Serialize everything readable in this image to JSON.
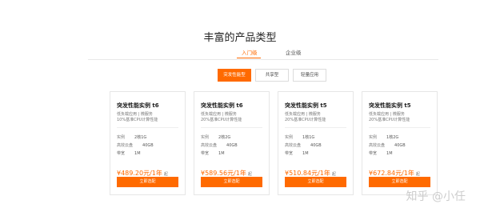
{
  "section": {
    "title": "丰富的产品类型"
  },
  "tabs": [
    {
      "label": "入门级",
      "active": true
    },
    {
      "label": "企业级",
      "active": false
    }
  ],
  "filters": [
    {
      "label": "突发性能型",
      "active": true
    },
    {
      "label": "共享型",
      "active": false
    },
    {
      "label": "轻量应用",
      "active": false
    }
  ],
  "cards": [
    {
      "title": "突发性能实例 t6",
      "line1": "低负载应用 | 微服务",
      "line2": "10%基准CPU计算性能",
      "specs": [
        {
          "label": "实例",
          "value": "2核1G"
        },
        {
          "label": "高效云盘",
          "value": "40GB"
        },
        {
          "label": "带宽",
          "value": "1M"
        }
      ],
      "price": "¥489.20元/1年",
      "price_suffix": "起",
      "button": "立即选配"
    },
    {
      "title": "突发性能实例 t6",
      "line1": "低负载应用 | 微服务",
      "line2": "20%基准CPU计算性能",
      "specs": [
        {
          "label": "实例",
          "value": "2核2G"
        },
        {
          "label": "高效云盘",
          "value": "40GB"
        },
        {
          "label": "带宽",
          "value": "1M"
        }
      ],
      "price": "¥589.56元/1年",
      "price_suffix": "起",
      "button": "立即选配"
    },
    {
      "title": "突发性能实例 t5",
      "line1": "低负载应用 | 微服务",
      "line2": "20%基准CPU计算性能",
      "specs": [
        {
          "label": "实例",
          "value": "1核1G"
        },
        {
          "label": "高效云盘",
          "value": "40GB"
        },
        {
          "label": "带宽",
          "value": "1M"
        }
      ],
      "price": "¥510.84元/1年",
      "price_suffix": "起",
      "button": "立即选配"
    },
    {
      "title": "突发性能实例 t5",
      "line1": "低负载应用 | 微服务",
      "line2": "20%基准CPU计算性能",
      "specs": [
        {
          "label": "实例",
          "value": "1核2G"
        },
        {
          "label": "高效云盘",
          "value": "40GB"
        },
        {
          "label": "带宽",
          "value": "1M"
        }
      ],
      "price": "¥672.84元/1年",
      "price_suffix": "起",
      "button": "立即选配"
    }
  ],
  "watermark": "知乎 @小任",
  "colors": {
    "accent": "#ff6a00"
  }
}
